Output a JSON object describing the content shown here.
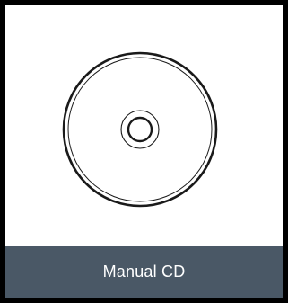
{
  "card": {
    "caption": "Manual CD",
    "icon": "cd-disc-icon"
  },
  "colors": {
    "frame": "#000000",
    "background": "#ffffff",
    "caption_bar": "#4a5866",
    "caption_text": "#ffffff",
    "icon_stroke": "#1a1a1a"
  }
}
